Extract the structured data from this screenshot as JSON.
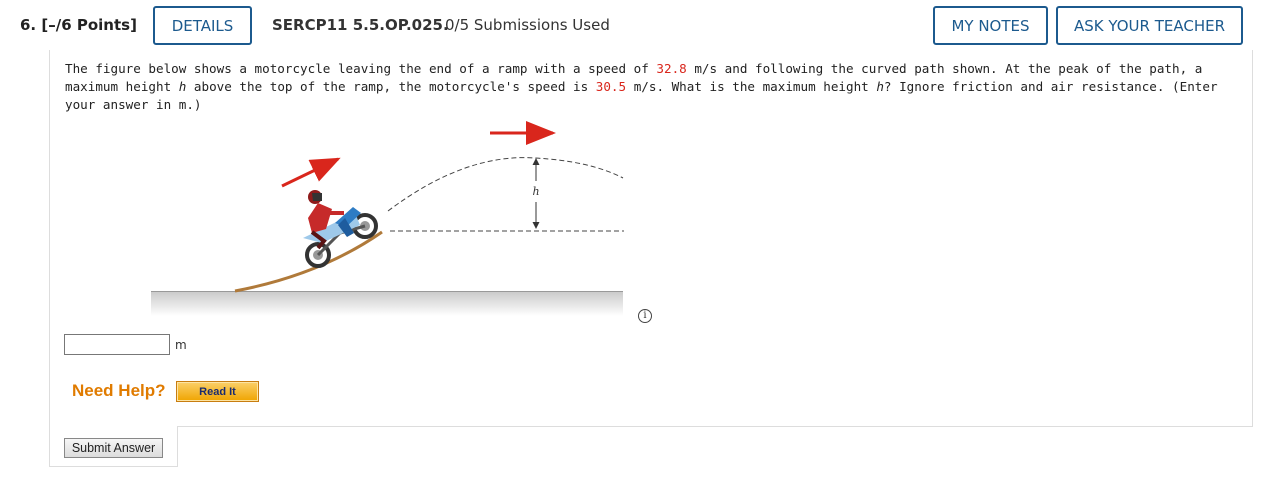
{
  "header": {
    "question_number": "6.",
    "points": "[–/6 Points]",
    "details_label": "DETAILS",
    "problem_code": "SERCP11 5.5.OP.025.",
    "submissions": "0/5 Submissions Used",
    "my_notes_label": "MY NOTES",
    "ask_teacher_label": "ASK YOUR TEACHER"
  },
  "question": {
    "part1": "The figure below shows a motorcycle leaving the end of a ramp with a speed of ",
    "speed1": "32.8",
    "part2": " m/s and following the curved path shown. At the peak of the path, a maximum height ",
    "h1": "h",
    "part3": " above the top of the ramp, the motorcycle's speed is ",
    "speed2": "30.5",
    "part4": " m/s. What is the maximum height ",
    "h2": "h",
    "part5": "? Ignore friction and air resistance. (Enter your answer in m.)"
  },
  "figure": {
    "h_label": "h",
    "info_icon": "info-circle-icon",
    "arrow_color": "#d9261c"
  },
  "answer": {
    "value": "",
    "unit": "m"
  },
  "help": {
    "label": "Need Help?",
    "read_it_label": "Read It"
  },
  "submit_label": "Submit Answer",
  "colors": {
    "accent": "#1c5a8e",
    "highlight_red": "#d9261c",
    "help_orange": "#e07b00"
  }
}
